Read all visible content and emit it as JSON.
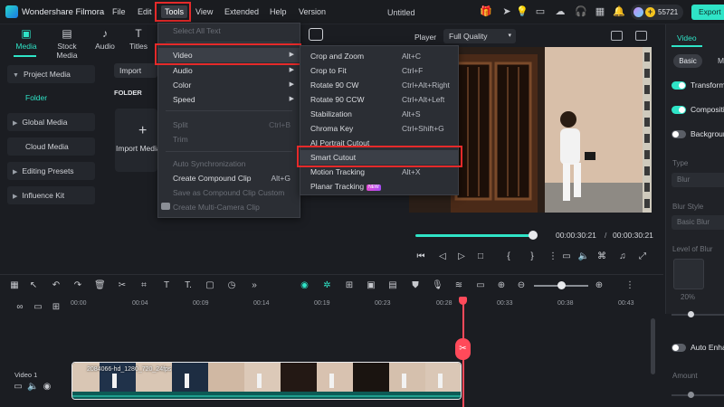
{
  "titlebar": {
    "app_name": "Wondershare Filmora",
    "menu": [
      "File",
      "Edit",
      "Tools",
      "View",
      "Extended",
      "Help",
      "Version"
    ],
    "doc_title": "Untitled",
    "credits": "55721",
    "export_label": "Export"
  },
  "toolbar": {
    "tools": [
      "Media",
      "Stock Media",
      "Audio",
      "Titles"
    ]
  },
  "left_panel": {
    "items": [
      "Project Media",
      "Global Media",
      "Cloud Media",
      "Editing Presets",
      "Influence Kit"
    ],
    "sub_folder": "Folder"
  },
  "media": {
    "import_dropdown": "Import",
    "folder_label": "FOLDER",
    "import_tile_label": "Import Media"
  },
  "tools_menu": {
    "items": [
      {
        "label": "Select All Text",
        "shortcut": ""
      },
      {
        "label": "Video",
        "shortcut": ""
      },
      {
        "label": "Audio",
        "shortcut": ""
      },
      {
        "label": "Color",
        "shortcut": ""
      },
      {
        "label": "Speed",
        "shortcut": ""
      },
      {
        "label": "Split",
        "shortcut": "Ctrl+B"
      },
      {
        "label": "Trim",
        "shortcut": ""
      },
      {
        "label": "Auto Synchronization",
        "shortcut": ""
      },
      {
        "label": "Create Compound Clip",
        "shortcut": "Alt+G"
      },
      {
        "label": "Save as Compound Clip Custom",
        "shortcut": ""
      },
      {
        "label": "Create Multi-Camera Clip",
        "shortcut": ""
      }
    ]
  },
  "video_submenu": {
    "items": [
      {
        "label": "Crop and Zoom",
        "shortcut": "Alt+C"
      },
      {
        "label": "Crop to Fit",
        "shortcut": "Ctrl+F"
      },
      {
        "label": "Rotate 90 CW",
        "shortcut": "Ctrl+Alt+Right"
      },
      {
        "label": "Rotate 90 CCW",
        "shortcut": "Ctrl+Alt+Left"
      },
      {
        "label": "Stabilization",
        "shortcut": "Alt+S"
      },
      {
        "label": "Chroma Key",
        "shortcut": "Ctrl+Shift+G"
      },
      {
        "label": "AI Portrait Cutout",
        "shortcut": ""
      },
      {
        "label": "Smart Cutout",
        "shortcut": ""
      },
      {
        "label": "Motion Tracking",
        "shortcut": "Alt+X"
      },
      {
        "label": "Planar Tracking",
        "shortcut": ""
      }
    ],
    "new_badge": "NEW"
  },
  "player": {
    "label": "Player",
    "quality": "Full Quality",
    "time_current": "00:00:30:21",
    "time_separator": "/",
    "time_total": "00:00:30:21",
    "progress": 1.0
  },
  "right_panel": {
    "tabs": [
      "Video"
    ],
    "basic_label": "Basic",
    "second_tab": "M",
    "toggles": [
      "Transform",
      "Compositing",
      "Background"
    ],
    "type_label": "Type",
    "type_value": "Blur",
    "blur_style_label": "Blur Style",
    "blur_style_value": "Basic Blur",
    "level_label": "Level of Blur",
    "level_value": "20%",
    "auto_enhance": "Auto Enha",
    "amount_label": "Amount"
  },
  "timeline": {
    "ticks": [
      "00:00",
      "00:04",
      "00:09",
      "00:14",
      "00:19",
      "00:23",
      "00:28",
      "00:33",
      "00:38",
      "00:43"
    ],
    "track_name": "Video 1",
    "clip_name": "2084066-hd_1280_720_24fps"
  },
  "colors": {
    "accent": "#2fe4c7",
    "highlight_box": "#e52a2a",
    "playhead": "#ff4a5a"
  }
}
